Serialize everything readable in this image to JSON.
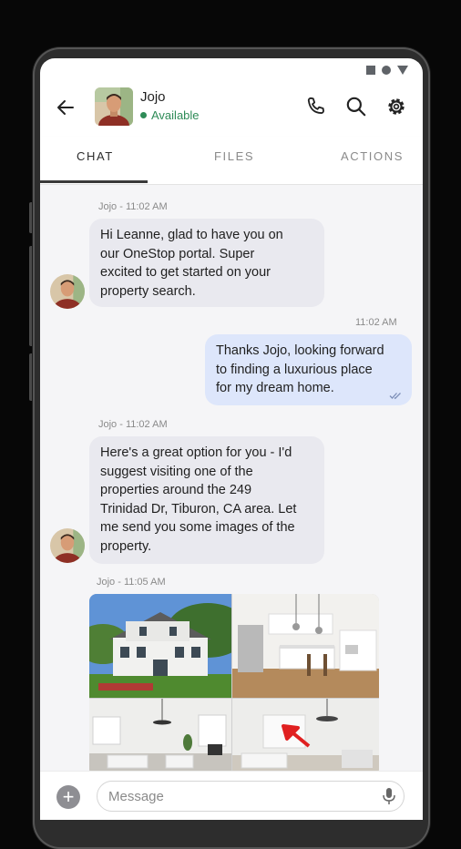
{
  "header": {
    "contact_name": "Jojo",
    "status": "Available"
  },
  "tabs": [
    {
      "label": "CHAT"
    },
    {
      "label": "FILES"
    },
    {
      "label": "ACTIONS"
    }
  ],
  "messages": [
    {
      "meta": "Jojo - 11:02 AM",
      "lines": [
        "Hi Leanne, glad to have you on",
        "our OneStop portal. Super",
        "excited to get started on your",
        "property search."
      ]
    },
    {
      "meta": "11:02 AM",
      "lines": [
        "Thanks Jojo, looking forward",
        "to finding a luxurious place",
        "for my dream home."
      ]
    },
    {
      "meta": "Jojo - 11:02 AM",
      "lines": [
        "Here's a great option for you - I'd",
        "suggest visiting one of the",
        "properties around the 249",
        "Trinidad Dr, Tiburon, CA area. Let",
        "me send you some images of the",
        "property."
      ]
    },
    {
      "meta": "Jojo - 11:05 AM"
    }
  ],
  "compose": {
    "placeholder": "Message"
  },
  "colors": {
    "status_green": "#2e8b57",
    "incoming_bubble": "#e9e9ef",
    "outgoing_bubble": "#dde6fb",
    "chat_background": "#f5f5f7"
  },
  "icons": [
    "back-arrow-icon",
    "phone-icon",
    "search-icon",
    "settings-gear-icon",
    "double-check-icon",
    "plus-icon",
    "microphone-icon"
  ]
}
